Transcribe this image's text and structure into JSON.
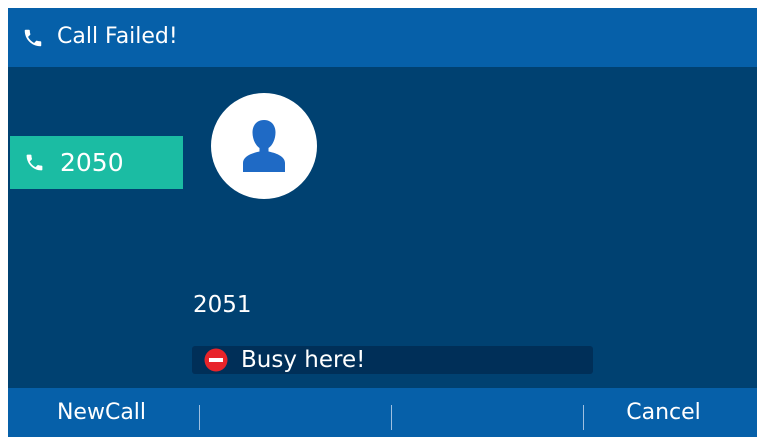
{
  "header": {
    "title": "Call Failed!",
    "icon": "phone-icon"
  },
  "line_key": {
    "label": "2050",
    "icon": "phone-icon",
    "color": "#1bbca3"
  },
  "call": {
    "avatar_icon": "contact-person-icon",
    "remote_number": "2051",
    "status_text": "Busy here!",
    "status_icon": "no-entry-icon",
    "status_icon_color": "#e8242a"
  },
  "softkeys": [
    {
      "label": "NewCall"
    },
    {
      "label": ""
    },
    {
      "label": ""
    },
    {
      "label": "Cancel"
    }
  ],
  "colors": {
    "background": "#004171",
    "bars": "#0660a9",
    "status_bg": "#002f58",
    "avatar": "#1f6ac5"
  }
}
